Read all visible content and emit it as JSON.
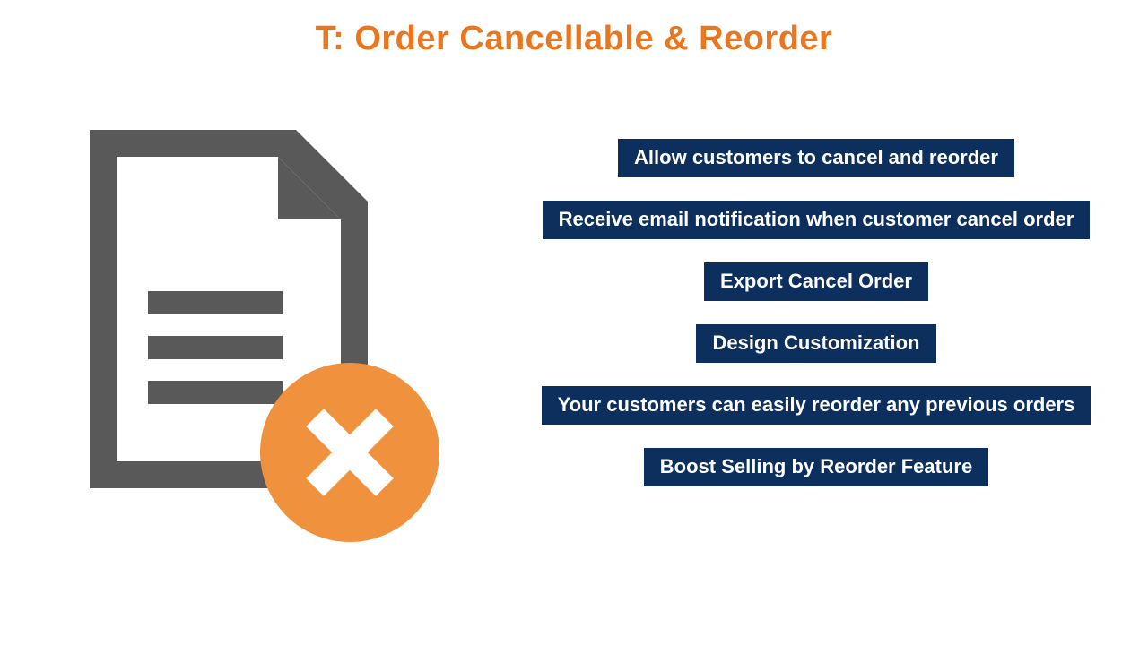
{
  "colors": {
    "title": "#e9771f",
    "feature_bg": "#0d2f5e",
    "feature_text": "#ffffff",
    "doc_gray": "#595959",
    "doc_white": "#ffffff",
    "badge_orange": "#f0913e",
    "badge_x": "#ffffff"
  },
  "title": "T: Order Cancellable & Reorder",
  "features": [
    "Allow customers to cancel and reorder",
    "Receive email notification when customer cancel order",
    "Export Cancel Order",
    "Design Customization",
    "Your customers can easily reorder any previous orders",
    "Boost Selling by Reorder Feature"
  ]
}
